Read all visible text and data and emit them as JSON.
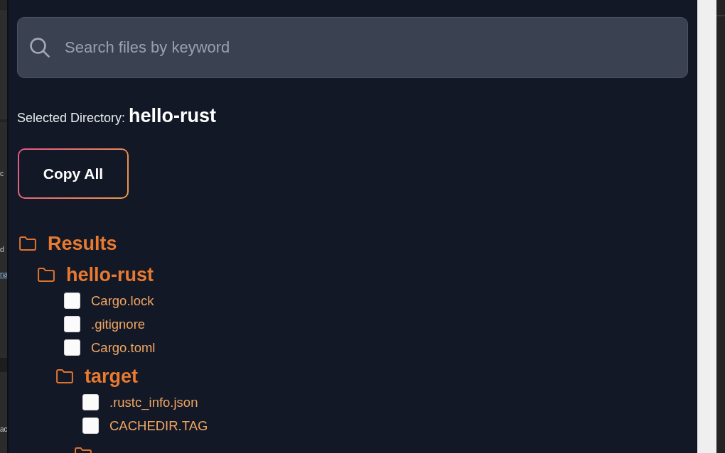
{
  "background_window": {
    "text_fragments": [
      {
        "text": "c",
        "kind": "text"
      },
      {
        "text": "d",
        "kind": "text"
      },
      {
        "text": "na",
        "kind": "link"
      },
      {
        "text": "ac",
        "kind": "text"
      }
    ]
  },
  "search": {
    "placeholder": "Search files by keyword"
  },
  "selected_directory": {
    "label": "Selected Directory:",
    "value": "hello-rust"
  },
  "copy_button": {
    "label": "Copy All"
  },
  "tree": {
    "kind": "folder",
    "name": "Results",
    "children": [
      {
        "kind": "folder",
        "name": "hello-rust",
        "children": [
          {
            "kind": "file",
            "name": "Cargo.lock",
            "checked": false
          },
          {
            "kind": "file",
            "name": ".gitignore",
            "checked": false
          },
          {
            "kind": "file",
            "name": "Cargo.toml",
            "checked": false
          },
          {
            "kind": "folder",
            "name": "target",
            "children": [
              {
                "kind": "file",
                "name": ".rustc_info.json",
                "checked": false
              },
              {
                "kind": "file",
                "name": "CACHEDIR.TAG",
                "checked": false
              },
              {
                "kind": "folder"
              }
            ]
          }
        ]
      }
    ]
  }
}
